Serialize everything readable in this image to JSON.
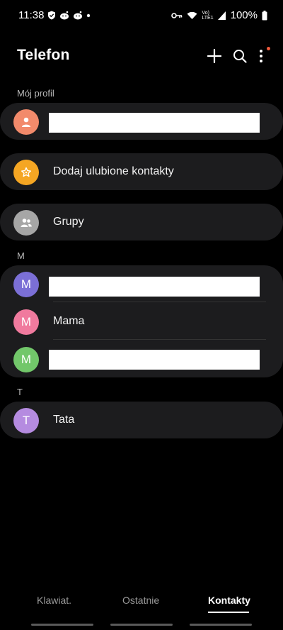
{
  "status_bar": {
    "time": "11:38",
    "battery": "100%",
    "network_label_top": "Vo)",
    "network_label_bottom": "LTE1"
  },
  "header": {
    "title": "Telefon",
    "add_icon": "plus-icon",
    "search_icon": "search-icon",
    "more_icon": "more-vertical-icon"
  },
  "profile_section": {
    "label": "Mój profil"
  },
  "favorites": {
    "label": "Dodaj ulubione kontakty",
    "icon": "star-icon",
    "color": "#f5a623"
  },
  "groups": {
    "label": "Grupy",
    "icon": "people-icon",
    "color": "#a6a6a6"
  },
  "sections": [
    {
      "letter": "M",
      "contacts": [
        {
          "initial": "M",
          "name": "",
          "redacted": true,
          "color": "#7b6fd6"
        },
        {
          "initial": "M",
          "name": "Mama",
          "redacted": false,
          "color": "#f07a9e"
        },
        {
          "initial": "M",
          "name": "",
          "redacted": true,
          "color": "#72c76a"
        }
      ]
    },
    {
      "letter": "T",
      "contacts": [
        {
          "initial": "T",
          "name": "Tata",
          "redacted": false,
          "color": "#b58be0"
        }
      ]
    }
  ],
  "tabs": [
    {
      "label": "Klawiat.",
      "active": false
    },
    {
      "label": "Ostatnie",
      "active": false
    },
    {
      "label": "Kontakty",
      "active": true
    }
  ],
  "colors": {
    "background": "#000000",
    "card": "#1c1c1e",
    "profile_avatar": "#f28a6b",
    "notification_dot": "#ef5a3c"
  }
}
